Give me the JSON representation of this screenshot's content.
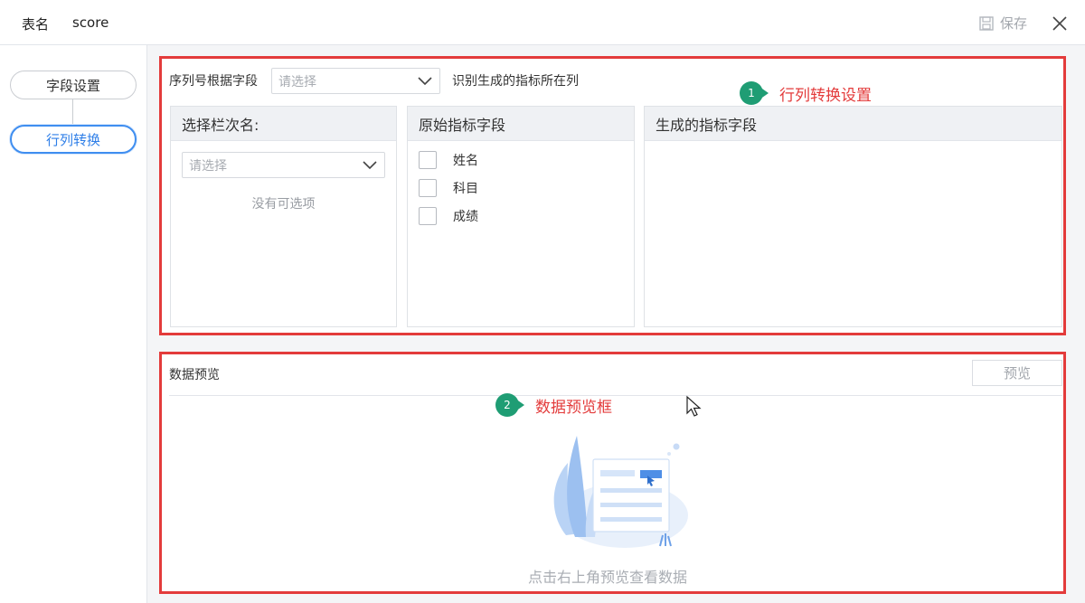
{
  "header": {
    "table_name_label": "表名",
    "table_name_value": "score",
    "save_label": "保存"
  },
  "sidebar": {
    "items": [
      {
        "label": "字段设置",
        "active": false
      },
      {
        "label": "行列转换",
        "active": true
      }
    ]
  },
  "settings": {
    "serial_label": "序列号根据字段",
    "serial_select_placeholder": "请选择",
    "serial_hint": "识别生成的指标所在列",
    "panels": {
      "select_column_title": "选择栏次名:",
      "select_column_placeholder": "请选择",
      "select_column_empty": "没有可选项",
      "original_fields_title": "原始指标字段",
      "original_fields": [
        "姓名",
        "科目",
        "成绩"
      ],
      "generated_fields_title": "生成的指标字段"
    }
  },
  "annotations": [
    {
      "number": "1",
      "text": "行列转换设置",
      "color": "#e33b3b"
    },
    {
      "number": "2",
      "text": "数据预览框",
      "color": "#e33b3b"
    }
  ],
  "preview": {
    "title": "数据预览",
    "button_label": "预览",
    "empty_hint": "点击右上角预览查看数据"
  },
  "colors": {
    "accent": "#3f8ef0",
    "highlight_border": "#e33b3b",
    "badge": "#1f9d74"
  }
}
